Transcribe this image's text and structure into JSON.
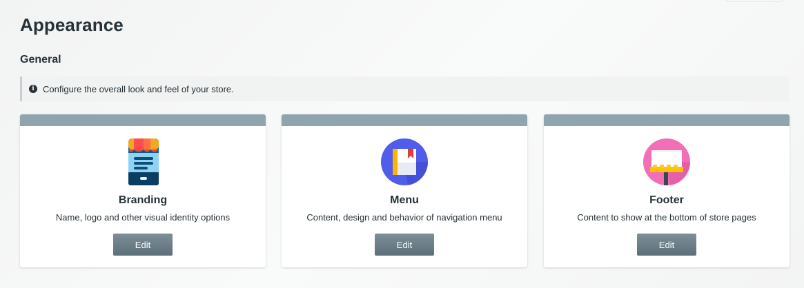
{
  "page": {
    "title": "Appearance"
  },
  "section": {
    "title": "General",
    "info_icon": "info-circle-icon",
    "info_text": "Configure the overall look and feel of your store."
  },
  "cards": [
    {
      "icon": "storefront-icon",
      "title": "Branding",
      "description": "Name, logo and other visual identity options",
      "button_label": "Edit"
    },
    {
      "icon": "book-menu-icon",
      "title": "Menu",
      "description": "Content, design and behavior of navigation menu",
      "button_label": "Edit"
    },
    {
      "icon": "billboard-icon",
      "title": "Footer",
      "description": "Content to show at the bottom of store pages",
      "button_label": "Edit"
    }
  ],
  "colors": {
    "card_header": "#90a4ae",
    "button": "#6b7d86",
    "text": "#263238"
  }
}
